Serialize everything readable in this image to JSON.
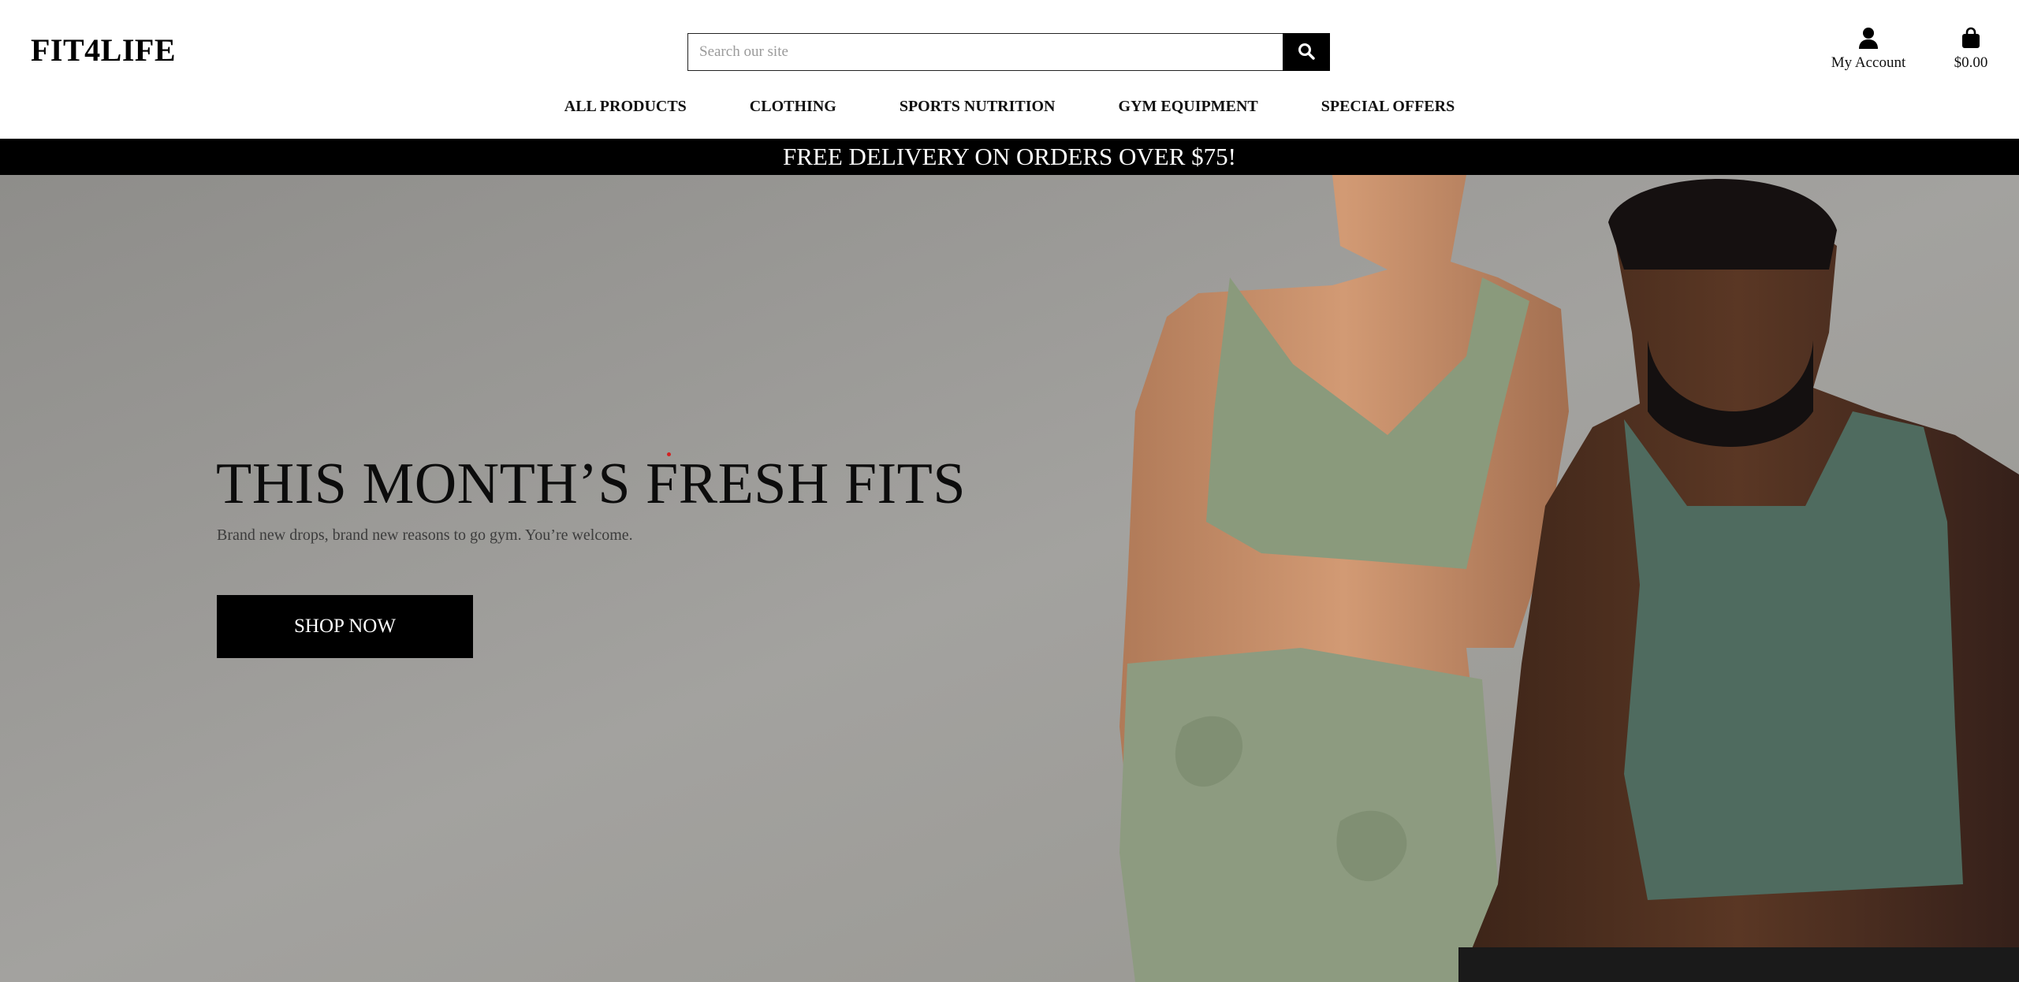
{
  "header": {
    "logo": "FIT4LIFE",
    "search_placeholder": "Search our site",
    "account_label": "My Account",
    "cart_total": "$0.00"
  },
  "nav": {
    "items": [
      {
        "label": "ALL PRODUCTS"
      },
      {
        "label": "CLOTHING"
      },
      {
        "label": "SPORTS NUTRITION"
      },
      {
        "label": "GYM EQUIPMENT"
      },
      {
        "label": "SPECIAL OFFERS"
      }
    ]
  },
  "promo": {
    "text": "FREE DELIVERY ON ORDERS OVER $75!"
  },
  "hero": {
    "title": "THIS MONTH’S FRESH FITS",
    "subtitle": "Brand new drops, brand new reasons to go gym. You’re welcome.",
    "cta_label": "SHOP NOW"
  },
  "icons": {
    "search": "search-icon",
    "account": "user-icon",
    "cart": "shopping-bag-icon"
  },
  "colors": {
    "banner_bg": "#000000",
    "hero_bg": "#9a9996",
    "top_outfit": "#8a9a7c",
    "tank_top": "#4f6b5f"
  }
}
